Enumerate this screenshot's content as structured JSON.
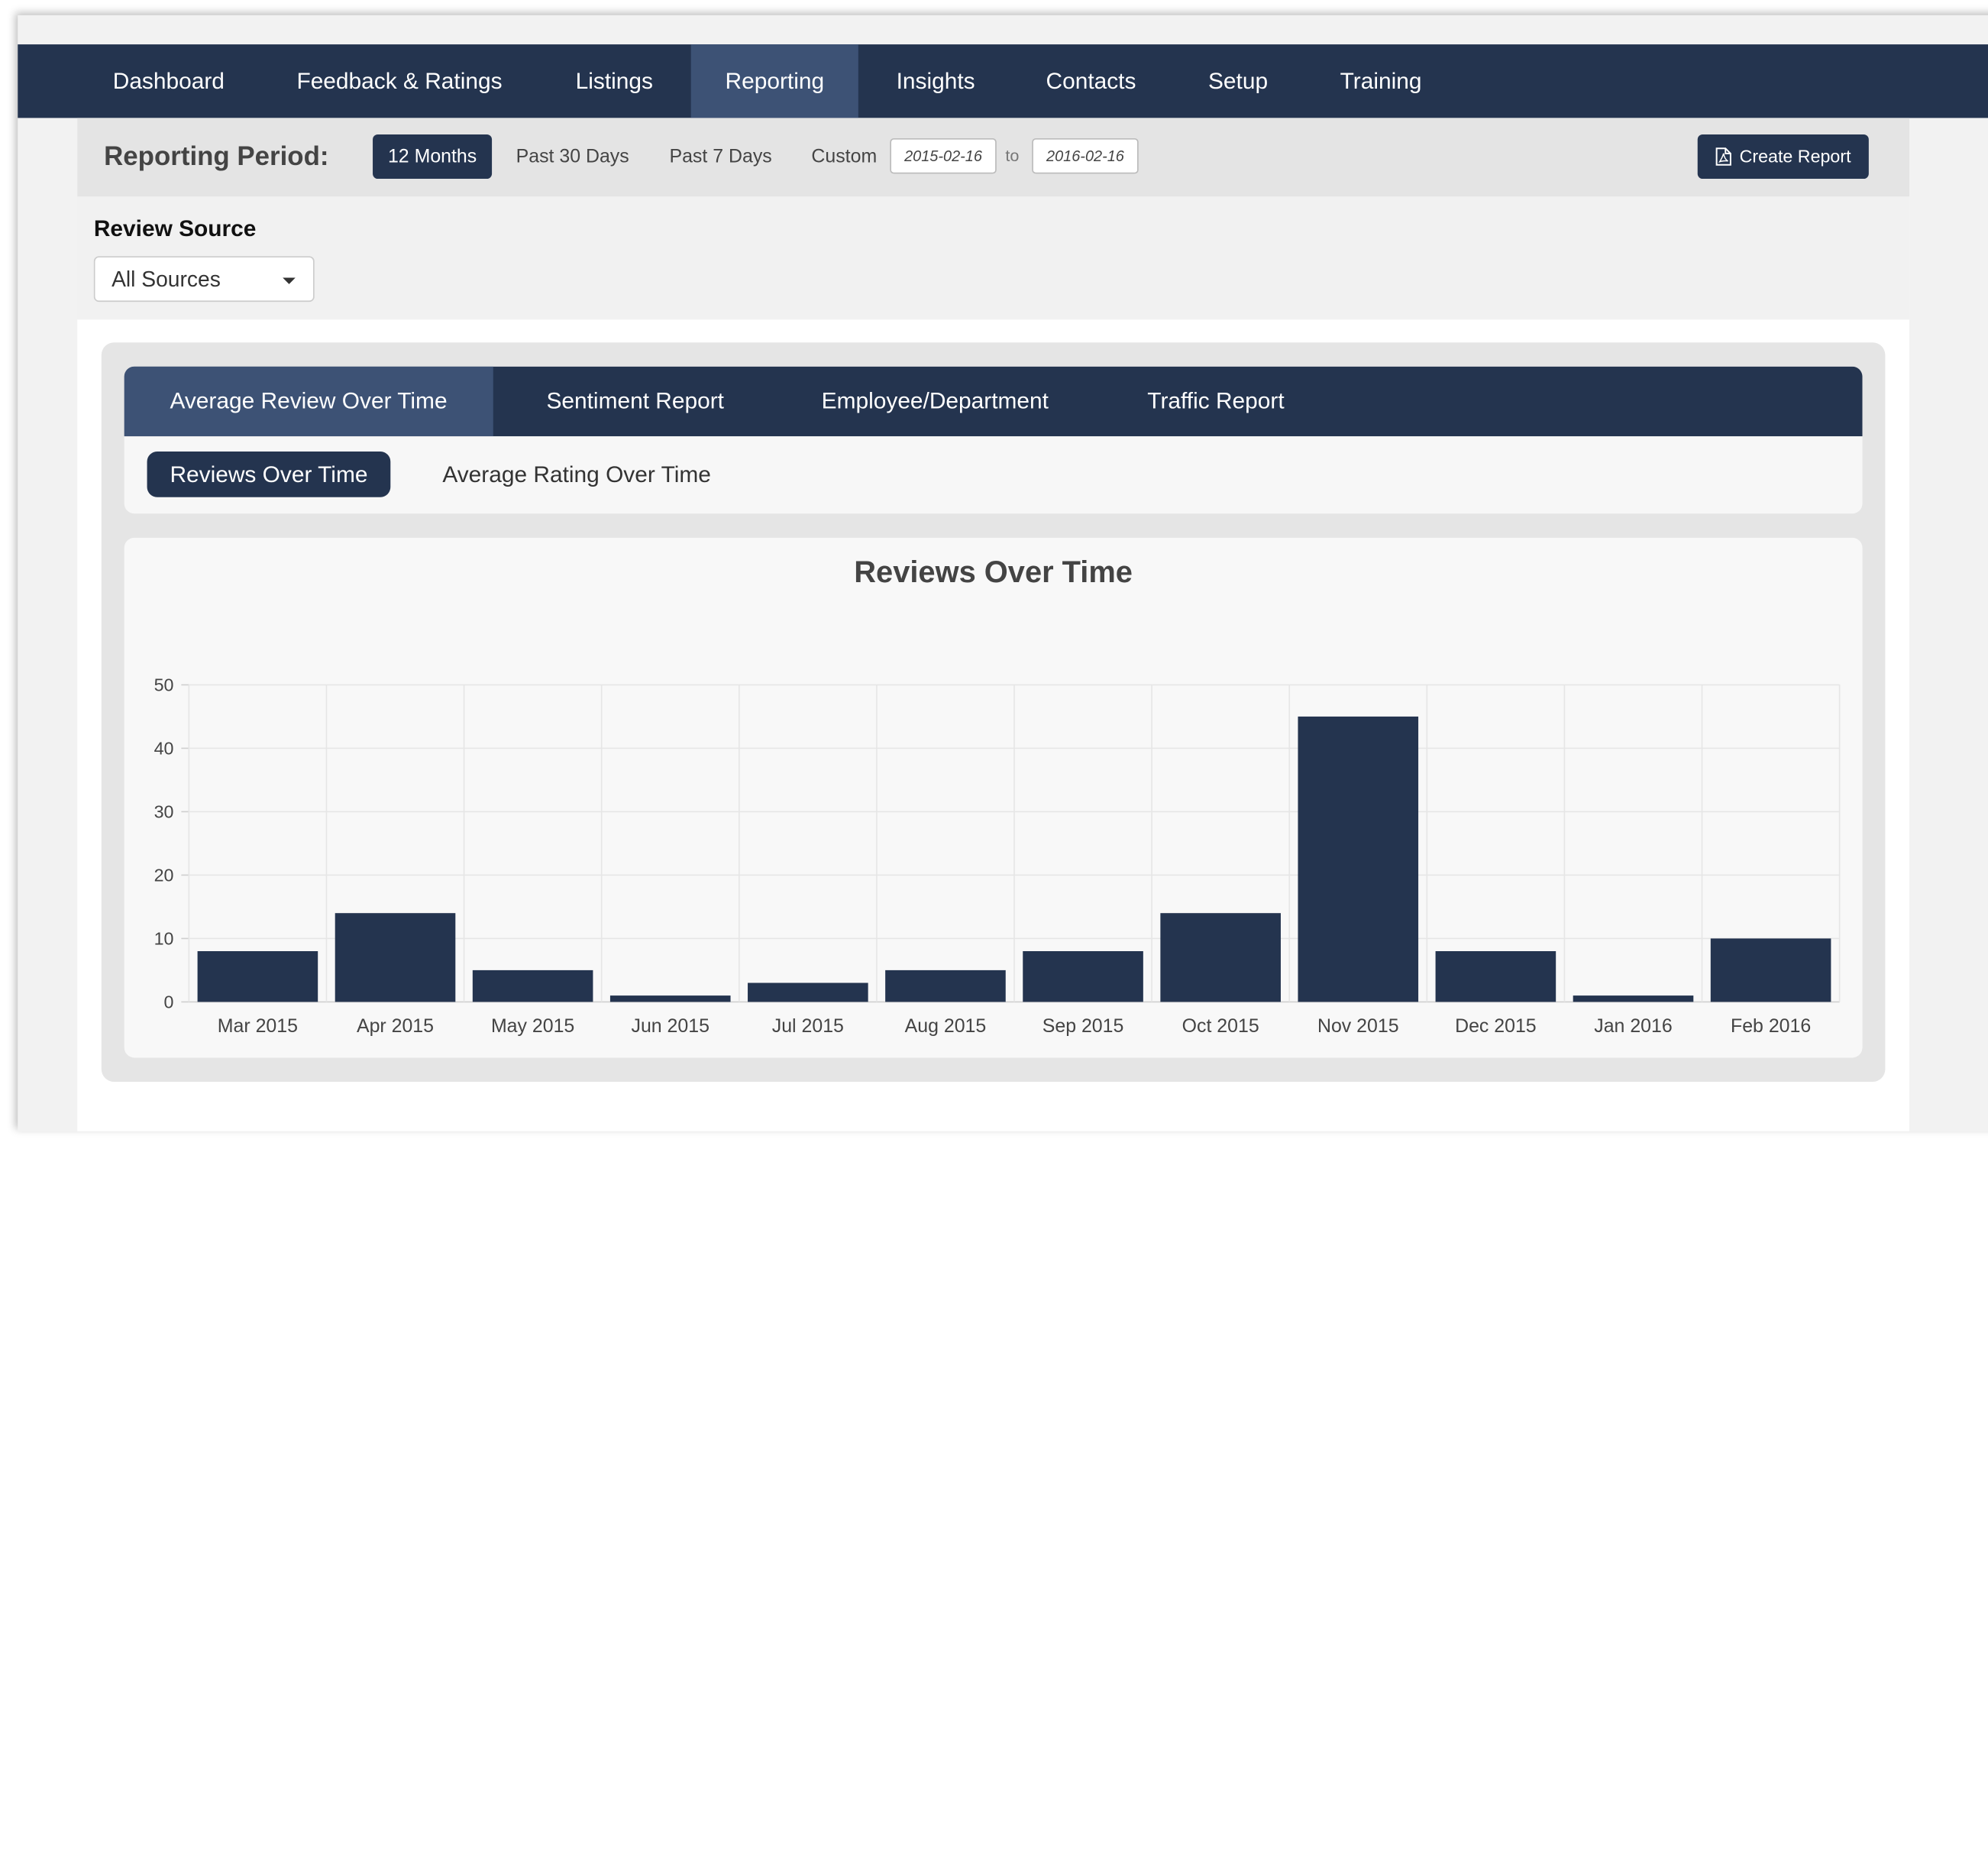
{
  "nav": {
    "items": [
      {
        "label": "Dashboard"
      },
      {
        "label": "Feedback & Ratings"
      },
      {
        "label": "Listings"
      },
      {
        "label": "Reporting"
      },
      {
        "label": "Insights"
      },
      {
        "label": "Contacts"
      },
      {
        "label": "Setup"
      },
      {
        "label": "Training"
      }
    ],
    "active": "Reporting"
  },
  "period": {
    "label": "Reporting Period:",
    "options": [
      {
        "label": "12 Months"
      },
      {
        "label": "Past 30 Days"
      },
      {
        "label": "Past 7 Days"
      },
      {
        "label": "Custom"
      }
    ],
    "selected": "12 Months",
    "from": "2015-02-16",
    "to_label": "to",
    "to": "2016-02-16",
    "create_report": "Create Report"
  },
  "review_source": {
    "label": "Review Source",
    "selected": "All Sources"
  },
  "report_tabs": {
    "items": [
      {
        "label": "Average Review Over Time"
      },
      {
        "label": "Sentiment Report"
      },
      {
        "label": "Employee/Department"
      },
      {
        "label": "Traffic Report"
      }
    ],
    "active": "Average Review Over Time"
  },
  "sub_tabs": {
    "items": [
      {
        "label": "Reviews Over Time"
      },
      {
        "label": "Average Rating Over Time"
      }
    ],
    "active": "Reviews Over Time"
  },
  "colors": {
    "navy": "#24344f",
    "active_tab": "#3d5275"
  },
  "icons": {
    "create_report": "pdf-document-icon",
    "source_dropdown": "caret-down-icon"
  },
  "chart_data": {
    "type": "bar",
    "title": "Reviews Over Time",
    "xlabel": "",
    "ylabel": "",
    "categories": [
      "Mar 2015",
      "Apr 2015",
      "May 2015",
      "Jun 2015",
      "Jul 2015",
      "Aug 2015",
      "Sep 2015",
      "Oct 2015",
      "Nov 2015",
      "Dec 2015",
      "Jan 2016",
      "Feb 2016"
    ],
    "values": [
      8,
      14,
      5,
      1,
      3,
      5,
      8,
      14,
      45,
      8,
      1,
      10
    ],
    "ylim": [
      0,
      50
    ],
    "yticks": [
      0,
      10,
      20,
      30,
      40,
      50
    ],
    "grid": true,
    "legend": "none",
    "bar_color": "#24344f"
  }
}
